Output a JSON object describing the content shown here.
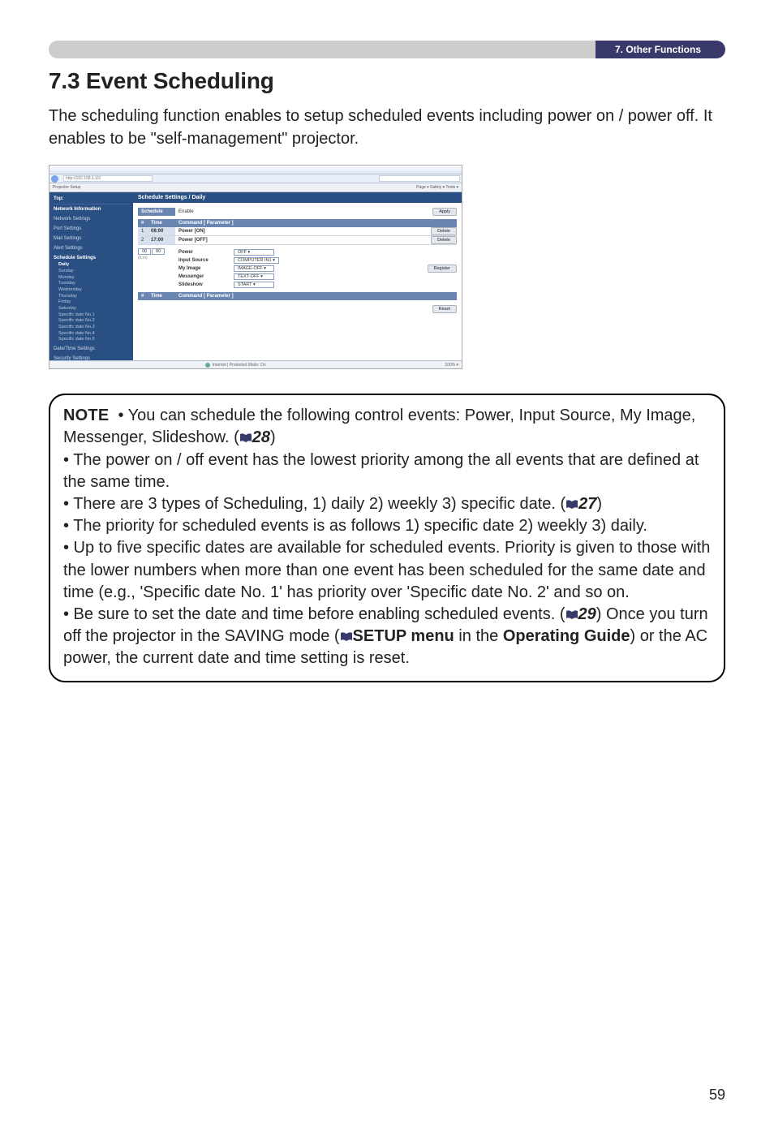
{
  "header": {
    "tag": "7. Other Functions"
  },
  "title": "7.3 Event Scheduling",
  "intro": "The scheduling function enables to setup scheduled events including power on / power off. It enables to be \"self-management\" projector.",
  "screenshot": {
    "url_text": "http://192.168.1.10/",
    "tab_label": "Projector Setup",
    "toolbar_right": "Page ▾  Safety ▾  Tools ▾",
    "section_title": "Schedule Settings / Daily",
    "schedule_label": "Schedule",
    "enable_label": "Enable",
    "apply_btn": "Apply",
    "col_num": "#",
    "col_time": "Time",
    "col_cmd": "Command [ Parameter ]",
    "rows": [
      {
        "n": "1",
        "time": "08:00",
        "cmd": "Power [ON]",
        "btn": "Delete"
      },
      {
        "n": "2",
        "time": "17:00",
        "cmd": "Power [OFF]",
        "btn": "Delete"
      }
    ],
    "new_time_h": "00",
    "new_time_m": "00",
    "new_time_sep": "(h:m)",
    "register_btn": "Register",
    "options": [
      {
        "label": "Power",
        "sel": "OFF ▾"
      },
      {
        "label": "Input Source",
        "sel": "COMPUTER IN1 ▾"
      },
      {
        "label": "My Image",
        "sel": "IMAGE-OFF ▾"
      },
      {
        "label": "Messenger",
        "sel": "TEXT-OFF ▾"
      },
      {
        "label": "Slideshow",
        "sel": "START ▾"
      }
    ],
    "reset_btn": "Reset",
    "sidebar": {
      "top": "Top:",
      "network_info": "Network Information",
      "network_settings": "Network Settings",
      "port_settings": "Port Settings",
      "mail_settings": "Mail Settings",
      "alert_settings": "Alert Settings",
      "schedule_settings": "Schedule Settings",
      "days": [
        "Daily",
        "Sunday",
        "Monday",
        "Tuesday",
        "Wednesday",
        "Thursday",
        "Friday",
        "Saturday",
        "Specific date No.1",
        "Specific date No.2",
        "Specific date No.3",
        "Specific date No.4",
        "Specific date No.5"
      ],
      "date_time": "Date/Time Settings",
      "security": "Security Settings"
    },
    "status_mid": "Internet | Protected Mode: On",
    "status_right": "100% ▾"
  },
  "note": {
    "label": "NOTE",
    "b1_pre": "• You can schedule the following control events: Power, Input Source, My Image, Messenger, Slideshow. (",
    "b1_ref": "28",
    "b1_post": ")",
    "b2": "• The power on / off event has the lowest priority among the all events that are defined at the same time.",
    "b3_pre": "• There are 3 types of Scheduling, 1) daily 2) weekly 3) specific date. (",
    "b3_ref": "27",
    "b3_post": ")",
    "b4": "• The priority for scheduled events is as follows 1) specific date 2) weekly 3) daily.",
    "b5": "• Up to five specific dates are available for scheduled events. Priority is given to those with the lower numbers when more than one event has been scheduled for the same date and time (e.g., 'Specific date No. 1' has priority over 'Specific date No. 2' and so on.",
    "b6_pre": "• Be sure to set the date and time before enabling scheduled events. (",
    "b6_ref": "29",
    "b6_post": ") Once you turn off the projector in the SAVING mode (",
    "b6_setup": "SETUP menu",
    "b6_mid": " in the ",
    "b6_guide": "Operating Guide",
    "b6_end": ") or the AC power, the current date and time setting is reset."
  },
  "pageno": "59"
}
